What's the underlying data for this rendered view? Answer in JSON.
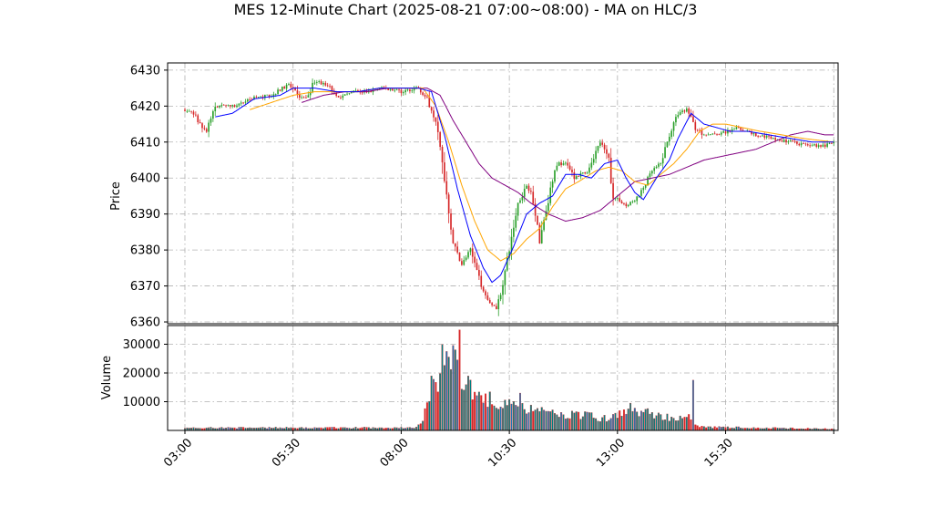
{
  "chart_data": {
    "type": "candlestick",
    "title": "MES 12-Minute Chart (2025-08-21 07:00~08:00) - MA on HLC/3",
    "price_panel": {
      "ylabel": "Price",
      "ylim": [
        6359.5,
        6432
      ],
      "yticks": [
        6360,
        6370,
        6380,
        6390,
        6400,
        6410,
        6420,
        6430
      ],
      "grid": true
    },
    "volume_panel": {
      "ylabel": "Volume",
      "ylim": [
        0,
        36500
      ],
      "yticks": [
        10000,
        20000,
        30000
      ],
      "grid": true
    },
    "x_axis": {
      "tick_labels": [
        "03:00",
        "05:30",
        "08:00",
        "10:30",
        "13:00",
        "15:30"
      ],
      "tick_hours": [
        3,
        5.5,
        8,
        10.5,
        13,
        15.5
      ],
      "extra_tick_hours": [
        18
      ],
      "xlim_hours": [
        2.6,
        18.1
      ]
    },
    "colors": {
      "up": "#2ca02c",
      "down": "#d62728",
      "ma_fast": "#0000ff",
      "ma_mid": "#ffa500",
      "ma_slow": "#800080",
      "volume_up": "#1f77b4",
      "volume_down": "#d62728",
      "volume_neutral": "#008080"
    },
    "price_anchors": [
      [
        3.0,
        6419
      ],
      [
        3.2,
        6418
      ],
      [
        3.4,
        6414
      ],
      [
        3.5,
        6413
      ],
      [
        3.7,
        6420
      ],
      [
        4.2,
        6420
      ],
      [
        4.5,
        6422
      ],
      [
        5.0,
        6423
      ],
      [
        5.4,
        6426
      ],
      [
        5.6,
        6423
      ],
      [
        5.8,
        6422
      ],
      [
        6.0,
        6427
      ],
      [
        6.3,
        6426
      ],
      [
        6.6,
        6422
      ],
      [
        6.8,
        6424
      ],
      [
        7.2,
        6424
      ],
      [
        7.6,
        6425
      ],
      [
        8.0,
        6424
      ],
      [
        8.4,
        6425
      ],
      [
        8.6,
        6422
      ],
      [
        8.8,
        6416
      ],
      [
        9.0,
        6400
      ],
      [
        9.2,
        6382
      ],
      [
        9.4,
        6376
      ],
      [
        9.6,
        6380
      ],
      [
        9.8,
        6372
      ],
      [
        10.0,
        6366
      ],
      [
        10.2,
        6364
      ],
      [
        10.3,
        6368
      ],
      [
        10.5,
        6380
      ],
      [
        10.7,
        6393
      ],
      [
        10.9,
        6398
      ],
      [
        11.0,
        6396
      ],
      [
        11.2,
        6383
      ],
      [
        11.4,
        6394
      ],
      [
        11.6,
        6404
      ],
      [
        11.8,
        6404
      ],
      [
        12.0,
        6400
      ],
      [
        12.3,
        6402
      ],
      [
        12.6,
        6410
      ],
      [
        12.8,
        6405
      ],
      [
        12.9,
        6395
      ],
      [
        13.2,
        6392
      ],
      [
        13.5,
        6395
      ],
      [
        13.8,
        6402
      ],
      [
        14.0,
        6404
      ],
      [
        14.2,
        6412
      ],
      [
        14.4,
        6418
      ],
      [
        14.6,
        6419
      ],
      [
        14.8,
        6414
      ],
      [
        15.0,
        6412
      ],
      [
        15.2,
        6412
      ],
      [
        15.6,
        6413
      ],
      [
        15.8,
        6414
      ],
      [
        16.2,
        6412
      ],
      [
        16.6,
        6411
      ],
      [
        17.0,
        6410
      ],
      [
        17.4,
        6409
      ],
      [
        17.8,
        6409
      ],
      [
        18.0,
        6410
      ]
    ],
    "volume_anchors": [
      [
        3.0,
        900
      ],
      [
        8.3,
        900
      ],
      [
        8.5,
        3000
      ],
      [
        8.65,
        12000
      ],
      [
        8.8,
        17000
      ],
      [
        9.0,
        25000
      ],
      [
        9.15,
        30000
      ],
      [
        9.4,
        17000
      ],
      [
        9.8,
        11000
      ],
      [
        10.3,
        10000
      ],
      [
        10.8,
        8000
      ],
      [
        11.5,
        6000
      ],
      [
        12.3,
        5000
      ],
      [
        12.8,
        4000
      ],
      [
        13.1,
        6000
      ],
      [
        13.5,
        7000
      ],
      [
        14.0,
        5000
      ],
      [
        14.5,
        4000
      ],
      [
        14.7,
        4500
      ],
      [
        14.9,
        1200
      ],
      [
        15.8,
        1000
      ],
      [
        18.0,
        500
      ]
    ],
    "volume_spikes": [
      [
        9.35,
        35000
      ],
      [
        14.75,
        17500
      ],
      [
        13.3,
        9500
      ],
      [
        10.75,
        13000
      ],
      [
        8.7,
        19000
      ]
    ],
    "ma_fast_anchors": [
      [
        3.7,
        6417
      ],
      [
        4.1,
        6418
      ],
      [
        4.6,
        6422
      ],
      [
        5.2,
        6423
      ],
      [
        5.5,
        6425
      ],
      [
        6.0,
        6425
      ],
      [
        6.5,
        6424
      ],
      [
        7.0,
        6424
      ],
      [
        7.5,
        6425
      ],
      [
        8.0,
        6425
      ],
      [
        8.4,
        6425
      ],
      [
        8.7,
        6424
      ],
      [
        9.0,
        6412
      ],
      [
        9.3,
        6397
      ],
      [
        9.6,
        6384
      ],
      [
        9.9,
        6375
      ],
      [
        10.1,
        6371
      ],
      [
        10.3,
        6373
      ],
      [
        10.6,
        6381
      ],
      [
        10.9,
        6390
      ],
      [
        11.2,
        6393
      ],
      [
        11.5,
        6395
      ],
      [
        11.8,
        6401
      ],
      [
        12.1,
        6401
      ],
      [
        12.4,
        6400
      ],
      [
        12.7,
        6404
      ],
      [
        13.0,
        6405
      ],
      [
        13.2,
        6400
      ],
      [
        13.4,
        6396
      ],
      [
        13.6,
        6394
      ],
      [
        13.9,
        6400
      ],
      [
        14.2,
        6405
      ],
      [
        14.4,
        6411
      ],
      [
        14.7,
        6418
      ],
      [
        15.0,
        6415
      ],
      [
        15.3,
        6414
      ],
      [
        15.6,
        6413
      ],
      [
        16.0,
        6413
      ],
      [
        16.5,
        6412
      ],
      [
        17.0,
        6411
      ],
      [
        17.5,
        6410
      ],
      [
        18.0,
        6410
      ]
    ],
    "ma_mid_anchors": [
      [
        4.5,
        6419
      ],
      [
        5.0,
        6421
      ],
      [
        5.5,
        6423
      ],
      [
        6.0,
        6424
      ],
      [
        6.5,
        6424
      ],
      [
        7.0,
        6424
      ],
      [
        7.5,
        6425
      ],
      [
        8.0,
        6425
      ],
      [
        8.5,
        6425
      ],
      [
        8.8,
        6420
      ],
      [
        9.1,
        6410
      ],
      [
        9.4,
        6398
      ],
      [
        9.7,
        6388
      ],
      [
        10.0,
        6380
      ],
      [
        10.3,
        6377
      ],
      [
        10.6,
        6379
      ],
      [
        10.9,
        6383
      ],
      [
        11.2,
        6386
      ],
      [
        11.5,
        6392
      ],
      [
        11.8,
        6397
      ],
      [
        12.1,
        6399
      ],
      [
        12.5,
        6402
      ],
      [
        12.8,
        6403
      ],
      [
        13.1,
        6402
      ],
      [
        13.4,
        6399
      ],
      [
        13.7,
        6398
      ],
      [
        14.0,
        6401
      ],
      [
        14.3,
        6404
      ],
      [
        14.6,
        6408
      ],
      [
        14.9,
        6413
      ],
      [
        15.2,
        6415
      ],
      [
        15.5,
        6415
      ],
      [
        15.9,
        6414
      ],
      [
        16.3,
        6413
      ],
      [
        16.8,
        6412
      ],
      [
        17.3,
        6411
      ],
      [
        18.0,
        6410
      ]
    ],
    "ma_slow_anchors": [
      [
        5.7,
        6421
      ],
      [
        6.2,
        6423
      ],
      [
        6.7,
        6424
      ],
      [
        7.2,
        6424
      ],
      [
        7.7,
        6425
      ],
      [
        8.2,
        6425
      ],
      [
        8.6,
        6425
      ],
      [
        8.9,
        6423
      ],
      [
        9.2,
        6416
      ],
      [
        9.5,
        6410
      ],
      [
        9.8,
        6404
      ],
      [
        10.1,
        6400
      ],
      [
        10.4,
        6398
      ],
      [
        10.7,
        6396
      ],
      [
        11.0,
        6393
      ],
      [
        11.4,
        6390
      ],
      [
        11.8,
        6388
      ],
      [
        12.2,
        6389
      ],
      [
        12.6,
        6391
      ],
      [
        13.0,
        6395
      ],
      [
        13.4,
        6399
      ],
      [
        13.8,
        6400
      ],
      [
        14.2,
        6401
      ],
      [
        14.6,
        6403
      ],
      [
        15.0,
        6405
      ],
      [
        15.4,
        6406
      ],
      [
        15.8,
        6407
      ],
      [
        16.2,
        6408
      ],
      [
        16.6,
        6410
      ],
      [
        17.0,
        6412
      ],
      [
        17.4,
        6413
      ],
      [
        17.8,
        6412
      ],
      [
        18.0,
        6412
      ]
    ]
  }
}
